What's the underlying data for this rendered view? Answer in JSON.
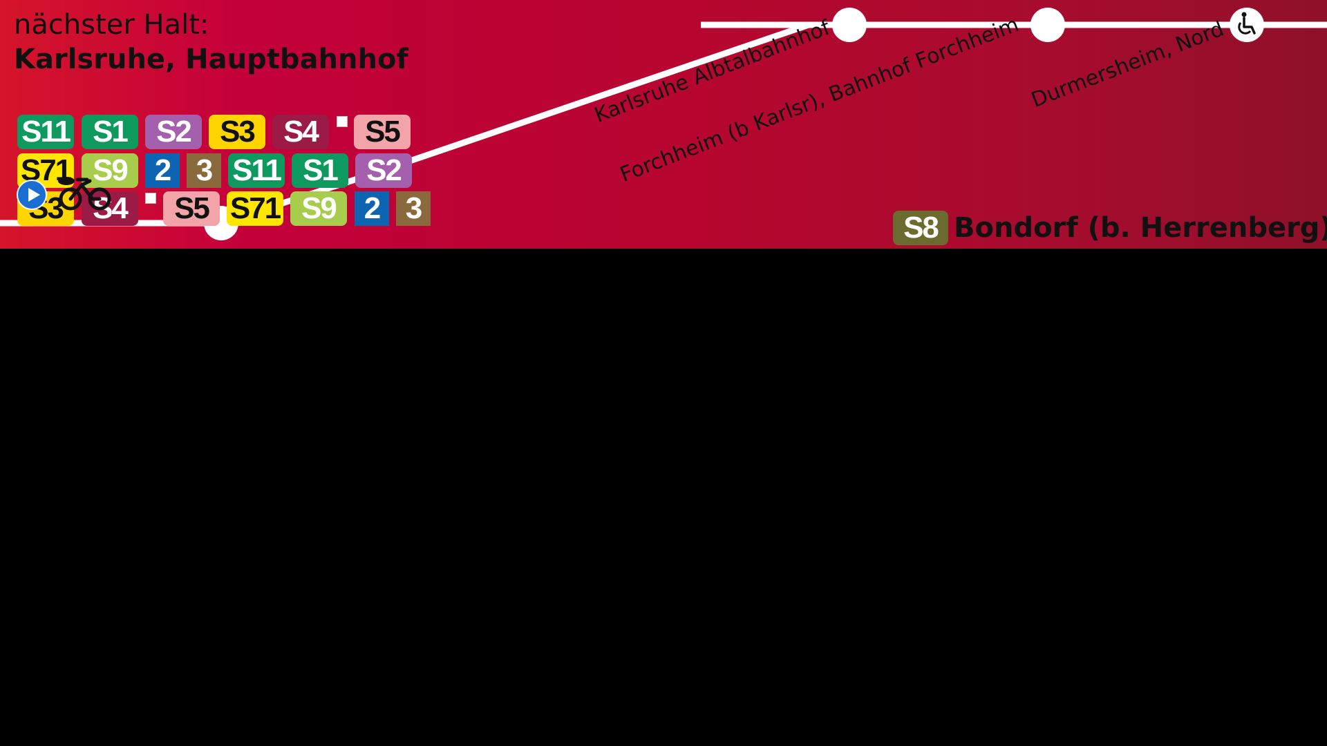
{
  "header": {
    "next_label": "nächster Halt:",
    "next_stop": "Karlsruhe, Hauptbahnhof"
  },
  "colors": {
    "S11": "#0e9a5e",
    "S1": "#0e9a5e",
    "S2": "#a560ad",
    "S3": "#ffd500",
    "S4": "#9b1a46",
    "S5": "#f3a4a8",
    "S71": "#ffe600",
    "S9": "#a8cc4b",
    "2": "#0d64b3",
    "3": "#8a6a3c",
    "S8": "#6b6a2f"
  },
  "lines": [
    {
      "label": "S11",
      "fg": "#ffffff"
    },
    {
      "label": "S1",
      "fg": "#ffffff"
    },
    {
      "label": "S2",
      "fg": "#ffffff"
    },
    {
      "label": "S3",
      "fg": "#111111"
    },
    {
      "label": "S4",
      "fg": "#ffffff"
    },
    {
      "label": "S5",
      "fg": "#111111"
    },
    {
      "label": "S71",
      "fg": "#111111"
    },
    {
      "label": "S9",
      "fg": "#ffffff"
    },
    {
      "label": "2",
      "fg": "#ffffff"
    },
    {
      "label": "3",
      "fg": "#ffffff"
    },
    {
      "label": "S11",
      "fg": "#ffffff"
    },
    {
      "label": "S1",
      "fg": "#ffffff"
    },
    {
      "label": "S2",
      "fg": "#ffffff"
    },
    {
      "label": "S3",
      "fg": "#111111"
    },
    {
      "label": "S4",
      "fg": "#ffffff"
    },
    {
      "label": "S5",
      "fg": "#111111"
    },
    {
      "label": "S71",
      "fg": "#111111"
    },
    {
      "label": "S9",
      "fg": "#ffffff"
    },
    {
      "label": "2",
      "fg": "#ffffff"
    },
    {
      "label": "3",
      "fg": "#ffffff"
    }
  ],
  "stations": [
    {
      "name": "Karlsruhe Albtalbahnhof"
    },
    {
      "name": "Forchheim (b Karlsr), Bahnhof Forchheim"
    },
    {
      "name": "Durmersheim, Nord"
    }
  ],
  "destination": {
    "line": "S8",
    "line_fg": "#ffffff",
    "name": "Bondorf (b. Herrenberg)"
  },
  "icons": {
    "play": "play-circle-icon",
    "bike": "bicycle-icon",
    "accessible": "wheelchair-icon"
  }
}
